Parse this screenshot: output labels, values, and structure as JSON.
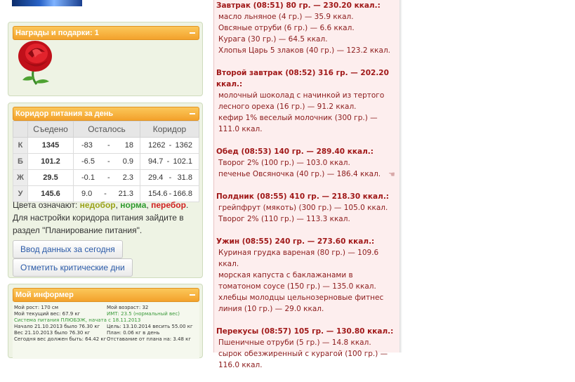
{
  "awards": {
    "title": "Награды и подарки: 1"
  },
  "corridor": {
    "title": "Коридор питания за день",
    "headers": [
      "Съедено",
      "Осталось",
      "Коридор"
    ],
    "rows": [
      {
        "label": "К",
        "eaten": "1345",
        "left_a": "-83",
        "left_b": "18",
        "corr_a": "1262",
        "corr_b": "1362",
        "color": "green"
      },
      {
        "label": "Б",
        "eaten": "101.2",
        "left_a": "-6.5",
        "left_b": "0.9",
        "corr_a": "94.7",
        "corr_b": "102.1",
        "color": "green"
      },
      {
        "label": "Ж",
        "eaten": "29.5",
        "left_a": "-0.1",
        "left_b": "2.3",
        "corr_a": "29.4",
        "corr_b": "31.8",
        "color": "green"
      },
      {
        "label": "У",
        "eaten": "145.6",
        "left_a": "9.0",
        "left_b": "21.3",
        "corr_a": "154.6",
        "corr_b": "166.8",
        "color": "olive"
      }
    ],
    "dash": "-",
    "legend_prefix": "Цвета означают: ",
    "legend_word1": "недобор",
    "legend_comma1": ", ",
    "legend_word2": "норма",
    "legend_comma2": ", ",
    "legend_word3": "перебор",
    "legend_end": ".",
    "legend_text": "Для настройки коридора питания зайдите в раздел \"Планирование питания\".",
    "button_enter": "Ввод данных за сегодня",
    "button_critical": "Отметить критические дни"
  },
  "informer": {
    "title": "Мой информер",
    "left_lines": [
      "Мой рост: 170 см",
      "Мой текущий вес: 67.9 кг",
      "Система питания ПЛЮБЭЖ, начата с 18.11.2013",
      "Начало 21.10.2013 было 76.30 кг",
      "Вес 21.10.2013 было 76.30 кг",
      "Сегодня вес должен быть: 64.42 кг"
    ],
    "right_lines": [
      "Мой возраст: 32",
      "ИМТ: 23.5 (нормальный вес)",
      "",
      "Цель: 13.10.2014 весить 55.00 кг",
      "План: 0.06 кг в день",
      "Отставание от плана на: 3.48 кг"
    ]
  },
  "diary": {
    "meals": [
      {
        "title": "Завтрак (08:51) 80 гр. — 230.20 ккал.:",
        "items": [
          "масло льняное (4 гр.) — 35.9 ккал.",
          "Овсяные отруби (6 гр.) — 6.6 ккал.",
          "Курага (30 гр.) — 64.5 ккал.",
          "Хлопья Царь 5 злаков (40 гр.) — 123.2 ккал."
        ]
      },
      {
        "title": "Второй завтрак (08:52) 316 гр. — 202.20 ккал.:",
        "items": [
          "молочный шоколад с начинкой из тертого лесного ореха (16 гр.) — 91.2 ккал.",
          "кефир 1% веселый молочник (300 гр.) — 111.0 ккал."
        ]
      },
      {
        "title": "Обед (08:53) 140 гр. — 289.40 ккал.:",
        "items": [
          "Творог 2% (100 гр.) — 103.0 ккал.",
          "печенье Овсяночка (40 гр.) — 186.4 ккал."
        ]
      },
      {
        "title": "Полдник (08:55) 410 гр. — 218.30 ккал.:",
        "items": [
          "грейпфрут (мякоть) (300 гр.) — 105.0 ккал.",
          "Творог 2% (110 гр.) — 113.3 ккал."
        ]
      },
      {
        "title": "Ужин (08:55) 240 гр. — 273.60 ккал.:",
        "items": [
          "Куриная грудка вареная (80 гр.) — 109.6 ккал.",
          "морская капуста с баклажанами в томатоном соусе (150 гр.) — 135.0 ккал.",
          "хлебцы молодцы цельнозерновые фитнес линия (10 гр.) — 29.0 ккал."
        ]
      },
      {
        "title": "Перекусы (08:57) 105 гр. — 130.80 ккал.:",
        "items": [
          "Пшеничные отруби (5 гр.) — 14.8 ккал.",
          "сырок обезжиренный с курагой (100 гр.) — 116.0 ккал."
        ]
      }
    ]
  },
  "colors": {
    "panel_header": "#f3a22c",
    "diary_text": "#8b1a1a",
    "norm": "#2f9a2f",
    "under": "#9aa21a",
    "over": "#d02020"
  }
}
